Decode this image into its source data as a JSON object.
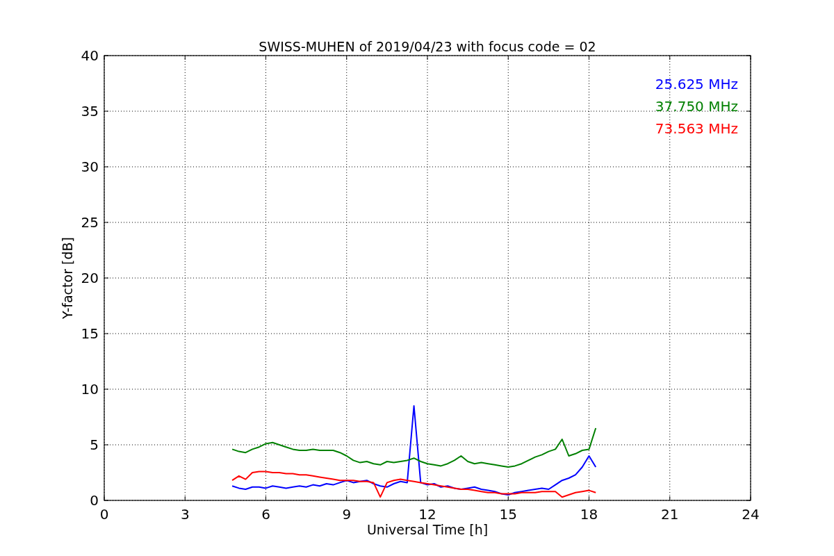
{
  "figure": {
    "chart_data": {
      "type": "line",
      "title": "SWISS-MUHEN of 2019/04/23 with focus code = 02",
      "xlabel": "Universal Time [h]",
      "ylabel": "Y-factor [dB]",
      "x": [
        4.75,
        5,
        5.25,
        5.5,
        5.75,
        6,
        6.25,
        6.5,
        6.75,
        7,
        7.25,
        7.5,
        7.75,
        8,
        8.25,
        8.5,
        8.75,
        9,
        9.25,
        9.5,
        9.75,
        10,
        10.25,
        10.5,
        10.75,
        11,
        11.25,
        11.5,
        11.75,
        12,
        12.25,
        12.5,
        12.75,
        13,
        13.25,
        13.5,
        13.75,
        14,
        14.25,
        14.5,
        14.75,
        15,
        15.25,
        15.5,
        15.75,
        16,
        16.25,
        16.5,
        16.75,
        17,
        17.25,
        17.5,
        17.75,
        18,
        18.25
      ],
      "series": [
        {
          "name": "25.625 MHz",
          "color": "#0000ff",
          "values": [
            1.3,
            1.1,
            1.0,
            1.2,
            1.2,
            1.1,
            1.3,
            1.2,
            1.1,
            1.2,
            1.3,
            1.2,
            1.4,
            1.3,
            1.5,
            1.4,
            1.6,
            1.8,
            1.6,
            1.7,
            1.8,
            1.5,
            1.3,
            1.2,
            1.5,
            1.7,
            1.6,
            8.5,
            1.6,
            1.4,
            1.5,
            1.2,
            1.3,
            1.1,
            1.0,
            1.1,
            1.2,
            1.0,
            0.9,
            0.8,
            0.6,
            0.5,
            0.7,
            0.8,
            0.9,
            1.0,
            1.1,
            1.0,
            1.4,
            1.8,
            2.0,
            2.3,
            3.0,
            4.0,
            3.0
          ]
        },
        {
          "name": "37.750 MHz",
          "color": "#008000",
          "values": [
            4.6,
            4.4,
            4.3,
            4.6,
            4.8,
            5.1,
            5.2,
            5.0,
            4.8,
            4.6,
            4.5,
            4.5,
            4.6,
            4.5,
            4.5,
            4.5,
            4.3,
            4.0,
            3.6,
            3.4,
            3.5,
            3.3,
            3.2,
            3.5,
            3.4,
            3.5,
            3.6,
            3.8,
            3.5,
            3.3,
            3.2,
            3.1,
            3.3,
            3.6,
            4.0,
            3.5,
            3.3,
            3.4,
            3.3,
            3.2,
            3.1,
            3.0,
            3.1,
            3.3,
            3.6,
            3.9,
            4.1,
            4.4,
            4.6,
            5.5,
            4.0,
            4.2,
            4.5,
            4.6,
            6.5
          ]
        },
        {
          "name": "73.563 MHz",
          "color": "#ff0000",
          "values": [
            1.8,
            2.2,
            1.9,
            2.5,
            2.6,
            2.6,
            2.5,
            2.5,
            2.4,
            2.4,
            2.3,
            2.3,
            2.2,
            2.1,
            2.0,
            1.9,
            1.8,
            1.8,
            1.8,
            1.7,
            1.7,
            1.6,
            0.3,
            1.6,
            1.8,
            1.9,
            1.8,
            1.7,
            1.6,
            1.5,
            1.4,
            1.3,
            1.2,
            1.1,
            1.0,
            1.0,
            0.9,
            0.8,
            0.7,
            0.7,
            0.6,
            0.6,
            0.6,
            0.7,
            0.7,
            0.7,
            0.8,
            0.8,
            0.8,
            0.3,
            0.5,
            0.7,
            0.8,
            0.9,
            0.7
          ]
        }
      ],
      "grid": true,
      "xlim": [
        0,
        24
      ],
      "ylim": [
        0,
        40
      ],
      "xticks": [
        0,
        3,
        6,
        9,
        12,
        15,
        18,
        21,
        24
      ],
      "yticks": [
        0,
        5,
        10,
        15,
        20,
        25,
        30,
        35,
        40
      ]
    }
  }
}
